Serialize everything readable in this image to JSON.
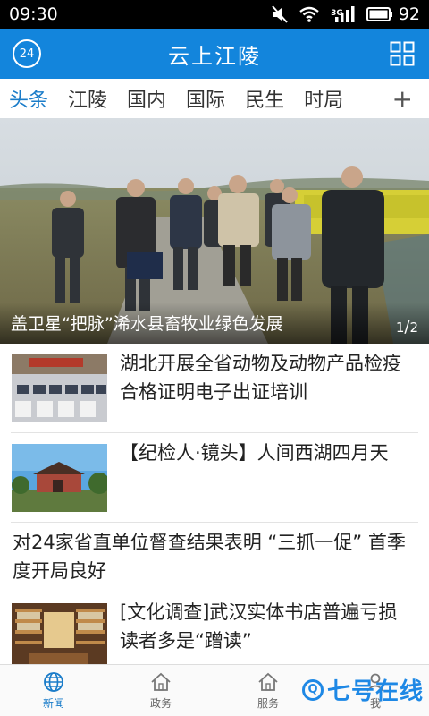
{
  "status_bar": {
    "time": "09:30",
    "network": "3G",
    "battery": "92",
    "icons": [
      "mute-icon",
      "wifi-icon",
      "signal-icon",
      "battery-icon"
    ]
  },
  "header": {
    "title": "云上江陵",
    "weather_badge": "24",
    "accent_color": "#1385dc"
  },
  "tabs": {
    "items": [
      "头条",
      "江陵",
      "国内",
      "国际",
      "民生",
      "时局"
    ],
    "active_index": 0,
    "add_label": "+"
  },
  "hero": {
    "caption": "盖卫星“把脉”浠水县畜牧业绿色发展",
    "pager_current": "1",
    "pager_total": "2"
  },
  "news": [
    {
      "title": "湖北开展全省动物及动物产品检疫合格证明电子出证培训",
      "has_thumb": true
    },
    {
      "title": "【纪检人·镜头】人间西湖四月天",
      "has_thumb": true
    },
    {
      "title": "对24家省直单位督查结果表明 “三抓一促” 首季度开局良好",
      "has_thumb": false
    },
    {
      "title": "[文化调查]武汉实体书店普遍亏损 读者多是“蹭读”",
      "has_thumb": true
    }
  ],
  "bottom_nav": {
    "items": [
      {
        "label": "新闻",
        "icon": "globe-icon",
        "active": true
      },
      {
        "label": "政务",
        "icon": "home-icon",
        "active": false
      },
      {
        "label": "服务",
        "icon": "home-icon",
        "active": false
      },
      {
        "label": "我",
        "icon": "person-icon",
        "active": false
      }
    ]
  },
  "watermark": {
    "text": "七号在线",
    "mark": "Q"
  }
}
